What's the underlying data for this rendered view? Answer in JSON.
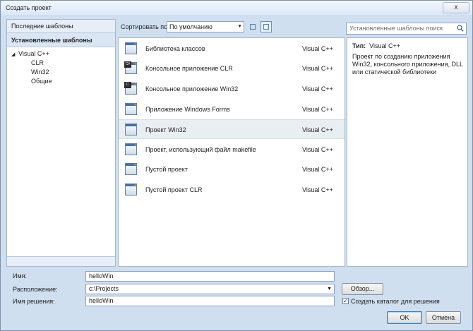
{
  "window": {
    "title": "Создать проект",
    "close_glyph": "x"
  },
  "sidebar": {
    "recent_label": "Последние шаблоны",
    "installed_label": "Установленные шаблоны",
    "tree": {
      "root_label": "Visual C++",
      "children": [
        "CLR",
        "Win32",
        "Общие"
      ]
    }
  },
  "toolbar": {
    "sort_label": "Сортировать по:",
    "sort_value": "По умолчанию"
  },
  "templates": [
    {
      "name": "Библиотека классов",
      "lang": "Visual C++",
      "icon": "class-library-icon"
    },
    {
      "name": "Консольное приложение CLR",
      "lang": "Visual C++",
      "icon": "clr-console-icon"
    },
    {
      "name": "Консольное приложение Win32",
      "lang": "Visual C++",
      "icon": "win32-console-icon"
    },
    {
      "name": "Приложение Windows Forms",
      "lang": "Visual C++",
      "icon": "windows-forms-icon"
    },
    {
      "name": "Проект Win32",
      "lang": "Visual C++",
      "icon": "win32-project-icon"
    },
    {
      "name": "Проект, использующий файл makefile",
      "lang": "Visual C++",
      "icon": "makefile-project-icon"
    },
    {
      "name": "Пустой проект",
      "lang": "Visual C++",
      "icon": "empty-project-icon"
    },
    {
      "name": "Пустой проект CLR",
      "lang": "Visual C++",
      "icon": "empty-clr-project-icon"
    }
  ],
  "selected_template_index": 4,
  "search": {
    "placeholder": "Установленные шаблоны поиск"
  },
  "info": {
    "type_label": "Тип:",
    "type_value": "Visual C++",
    "description": "Проект по созданию приложения Win32, консольного приложения, DLL или статической библиотеки"
  },
  "form": {
    "name_label": "Имя:",
    "name_value": "helloWin",
    "location_label": "Расположение:",
    "location_value": "c:\\Projects",
    "solution_label": "Имя решения:",
    "solution_value": "helloWin",
    "browse_label": "Обзор...",
    "create_dir_label": "Создать каталог для решения",
    "create_dir_checked": true
  },
  "buttons": {
    "ok_label": "OK",
    "cancel_label": "Отмена"
  }
}
